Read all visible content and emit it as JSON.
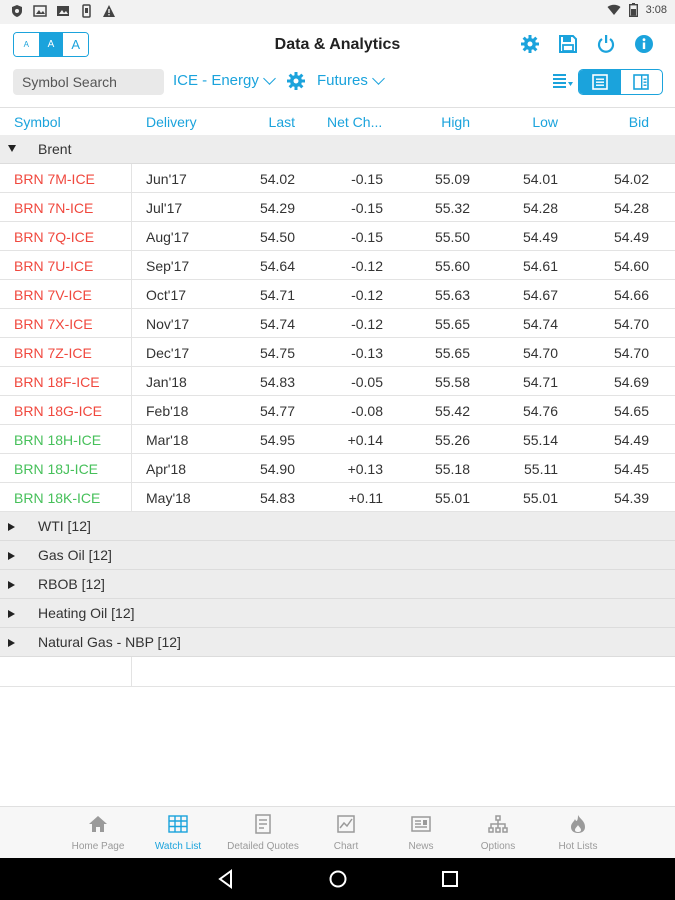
{
  "status_bar": {
    "time": "3:08",
    "left_icons": [
      "shield-icon",
      "image-icon",
      "photo-icon",
      "phone-icon",
      "warning-icon"
    ],
    "right_icons": [
      "wifi-icon",
      "battery-icon"
    ]
  },
  "header": {
    "title": "Data & Analytics",
    "font_size_options": [
      "A",
      "A",
      "A"
    ],
    "icons": [
      "settings-icon",
      "save-icon",
      "power-icon",
      "info-icon"
    ]
  },
  "filters": {
    "search_label": "Symbol Search",
    "exchange": "ICE - Energy",
    "type": "Futures"
  },
  "table": {
    "columns": [
      "Symbol",
      "Delivery",
      "Last",
      "Net Ch...",
      "High",
      "Low",
      "Bid"
    ],
    "expanded_group": "Brent",
    "rows": [
      {
        "symbol": "BRN 7M-ICE",
        "delivery": "Jun'17",
        "last": "54.02",
        "net": "-0.15",
        "high": "55.09",
        "low": "54.01",
        "bid": "54.02",
        "dir": "down"
      },
      {
        "symbol": "BRN 7N-ICE",
        "delivery": "Jul'17",
        "last": "54.29",
        "net": "-0.15",
        "high": "55.32",
        "low": "54.28",
        "bid": "54.28",
        "dir": "down"
      },
      {
        "symbol": "BRN 7Q-ICE",
        "delivery": "Aug'17",
        "last": "54.50",
        "net": "-0.15",
        "high": "55.50",
        "low": "54.49",
        "bid": "54.49",
        "dir": "down"
      },
      {
        "symbol": "BRN 7U-ICE",
        "delivery": "Sep'17",
        "last": "54.64",
        "net": "-0.12",
        "high": "55.60",
        "low": "54.61",
        "bid": "54.60",
        "dir": "down"
      },
      {
        "symbol": "BRN 7V-ICE",
        "delivery": "Oct'17",
        "last": "54.71",
        "net": "-0.12",
        "high": "55.63",
        "low": "54.67",
        "bid": "54.66",
        "dir": "down"
      },
      {
        "symbol": "BRN 7X-ICE",
        "delivery": "Nov'17",
        "last": "54.74",
        "net": "-0.12",
        "high": "55.65",
        "low": "54.74",
        "bid": "54.70",
        "dir": "down"
      },
      {
        "symbol": "BRN 7Z-ICE",
        "delivery": "Dec'17",
        "last": "54.75",
        "net": "-0.13",
        "high": "55.65",
        "low": "54.70",
        "bid": "54.70",
        "dir": "down"
      },
      {
        "symbol": "BRN 18F-ICE",
        "delivery": "Jan'18",
        "last": "54.83",
        "net": "-0.05",
        "high": "55.58",
        "low": "54.71",
        "bid": "54.69",
        "dir": "down"
      },
      {
        "symbol": "BRN 18G-ICE",
        "delivery": "Feb'18",
        "last": "54.77",
        "net": "-0.08",
        "high": "55.42",
        "low": "54.76",
        "bid": "54.65",
        "dir": "down"
      },
      {
        "symbol": "BRN 18H-ICE",
        "delivery": "Mar'18",
        "last": "54.95",
        "net": "+0.14",
        "high": "55.26",
        "low": "55.14",
        "bid": "54.49",
        "dir": "up"
      },
      {
        "symbol": "BRN 18J-ICE",
        "delivery": "Apr'18",
        "last": "54.90",
        "net": "+0.13",
        "high": "55.18",
        "low": "55.11",
        "bid": "54.45",
        "dir": "up"
      },
      {
        "symbol": "BRN 18K-ICE",
        "delivery": "May'18",
        "last": "54.83",
        "net": "+0.11",
        "high": "55.01",
        "low": "55.01",
        "bid": "54.39",
        "dir": "up"
      }
    ],
    "collapsed_groups": [
      "WTI [12]",
      "Gas Oil [12]",
      "RBOB [12]",
      "Heating Oil [12]",
      "Natural Gas - NBP [12]"
    ]
  },
  "bottom_nav": {
    "items": [
      {
        "label": "Home Page",
        "icon": "home-icon"
      },
      {
        "label": "Watch List",
        "icon": "grid-icon",
        "active": true
      },
      {
        "label": "Detailed Quotes",
        "icon": "quote-icon"
      },
      {
        "label": "Chart",
        "icon": "chart-icon"
      },
      {
        "label": "News",
        "icon": "news-icon"
      },
      {
        "label": "Options",
        "icon": "tree-icon"
      },
      {
        "label": "Hot Lists",
        "icon": "flame-icon"
      }
    ]
  },
  "colors": {
    "accent": "#1ba3dc",
    "down": "#f0483e",
    "up": "#46c05a"
  }
}
